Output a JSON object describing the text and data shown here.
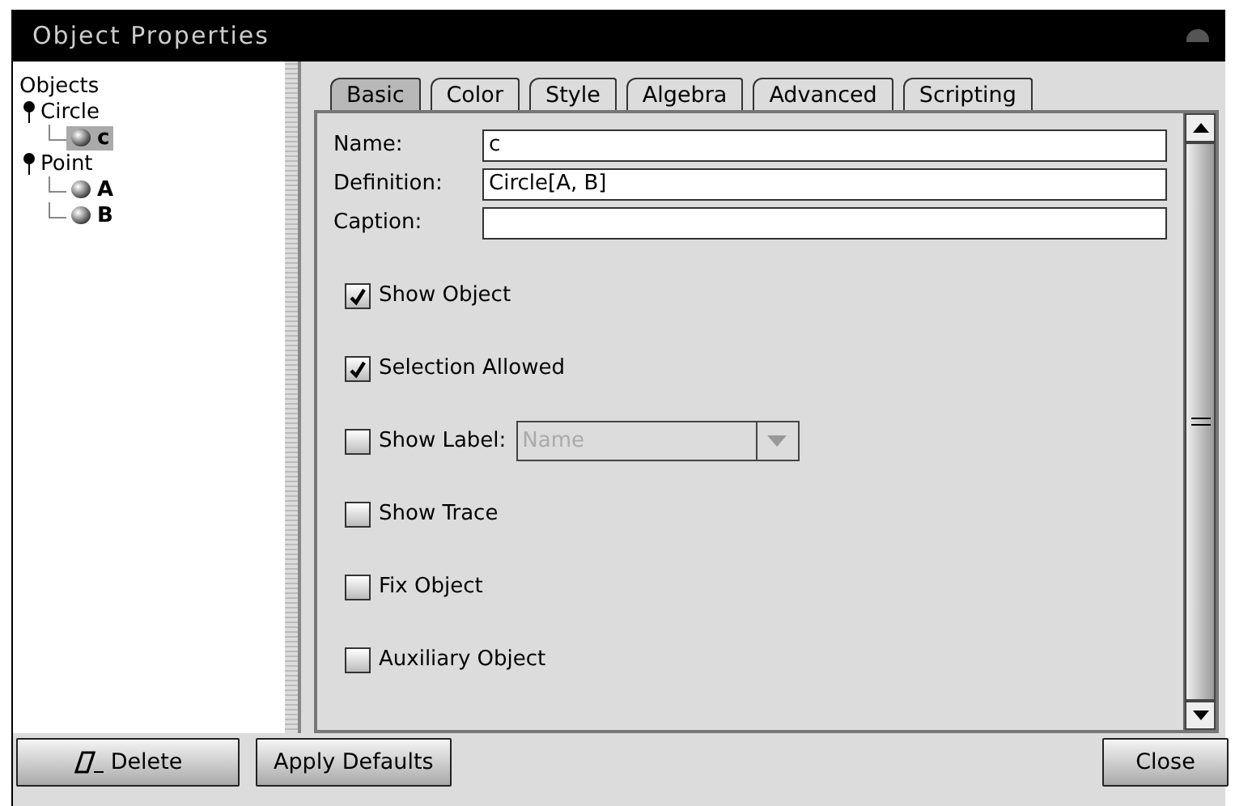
{
  "window": {
    "title": "Object Properties"
  },
  "tree": {
    "label": "Objects",
    "children": [
      {
        "label": "Circle",
        "expanded": true,
        "children": [
          {
            "label": "c",
            "selected": true
          }
        ]
      },
      {
        "label": "Point",
        "expanded": true,
        "children": [
          {
            "label": "A",
            "selected": false
          },
          {
            "label": "B",
            "selected": false
          }
        ]
      }
    ]
  },
  "tabs": [
    {
      "label": "Basic",
      "selected": true
    },
    {
      "label": "Color",
      "selected": false
    },
    {
      "label": "Style",
      "selected": false
    },
    {
      "label": "Algebra",
      "selected": false
    },
    {
      "label": "Advanced",
      "selected": false
    },
    {
      "label": "Scripting",
      "selected": false
    }
  ],
  "fields": [
    {
      "label": "Name:",
      "value": "c"
    },
    {
      "label": "Definition:",
      "value": "Circle[A, B]"
    },
    {
      "label": "Caption:"
    }
  ],
  "options": [
    {
      "label": "Show Object",
      "checked": true
    },
    {
      "label": "Selection Allowed",
      "checked": true
    },
    {
      "label": "Show Label:",
      "checked": false,
      "select": {
        "value": "Name",
        "disabled": true
      }
    },
    {
      "label": "Show Trace",
      "checked": false
    },
    {
      "label": "Fix Object",
      "checked": false
    },
    {
      "label": "Auxiliary Object",
      "checked": false
    }
  ],
  "buttons": {
    "left": [
      "Delete",
      "Apply Defaults"
    ],
    "right": [
      "Close"
    ]
  }
}
